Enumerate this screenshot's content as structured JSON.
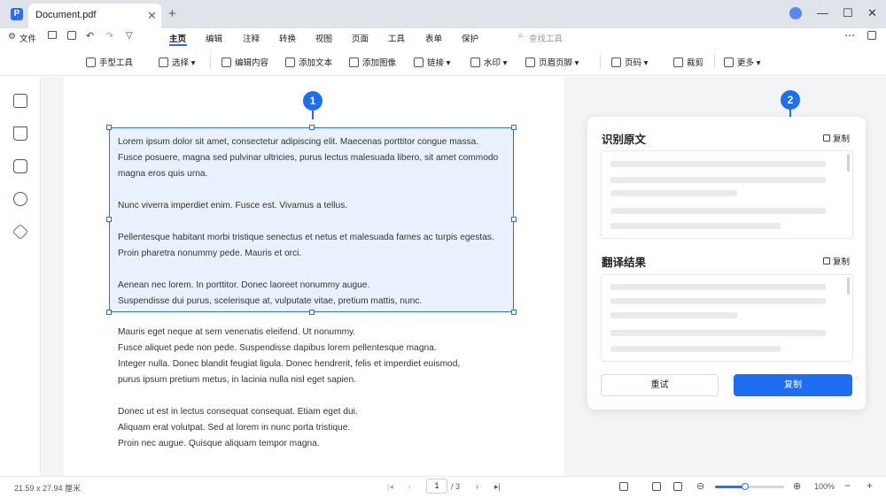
{
  "window": {
    "tab_title": "Document.pdf",
    "logo_letter": "P",
    "new_tab": "+",
    "tab_close": "✕",
    "controls": [
      "—",
      "☐",
      "✕"
    ]
  },
  "menu": {
    "file": "文件",
    "tabs": [
      "主页",
      "编辑",
      "注释",
      "转换",
      "视图",
      "页面",
      "工具",
      "表单",
      "保护"
    ],
    "active_tab": "主页",
    "search_placeholder": "查找工具",
    "more": "⋯"
  },
  "toolbar": {
    "items": [
      "手型工具",
      "选择",
      "编辑内容",
      "添加文本",
      "添加图像",
      "链接",
      "水印",
      "页眉页脚",
      "页码",
      "裁剪",
      "更多"
    ]
  },
  "document": {
    "selected_paragraphs": [
      [
        "Lorem ipsum dolor sit amet, consectetur adipiscing elit. Maecenas porttitor congue massa.",
        "Fusce posuere, magna sed pulvinar ultricies, purus lectus malesuada libero, sit amet commodo",
        "magna eros quis urna."
      ],
      [
        "Nunc viverra imperdiet enim. Fusce est. Vivamus a tellus."
      ],
      [
        "Pellentesque habitant morbi tristique senectus et netus et malesuada fames ac turpis egestas.",
        "Proin pharetra nonummy pede. Mauris et orci."
      ],
      [
        "Aenean nec lorem. In porttitor. Donec laoreet nonummy augue.",
        "Suspendisse dui purus, scelerisque at, vulputate vitae, pretium mattis, nunc."
      ]
    ],
    "other_paragraphs": [
      [
        "Mauris eget neque at sem venenatis eleifend. Ut nonummy.",
        "Fusce aliquet pede non pede. Suspendisse dapibus lorem pellentesque magna.",
        "Integer nulla. Donec blandit feugiat ligula. Donec hendrerit, felis et imperdiet euismod,",
        "purus ipsum pretium metus, in lacinia nulla nisl eget sapien."
      ],
      [
        "Donec ut est in lectus consequat consequat. Etiam eget dui.",
        "Aliquam erat volutpat. Sed at lorem in nunc porta tristique.",
        "Proin nec augue. Quisque aliquam tempor magna."
      ]
    ]
  },
  "badges": [
    "1",
    "2"
  ],
  "panel": {
    "source_title": "识别原文",
    "result_title": "翻译结果",
    "copy_label": "复制",
    "retry_button": "重试",
    "copy_button": "复制"
  },
  "status": {
    "page_size": "21.59 x 27.94 厘米",
    "current_page": "1",
    "total_pages": "/ 3",
    "zoom": "100%",
    "zoom_fraction": 0.42
  },
  "colors": {
    "accent": "#1d6ef0",
    "selection_fill": "#eaf1fe"
  },
  "icons": [
    "hand-icon",
    "cursor-icon",
    "edit-icon",
    "add-text-icon",
    "image-icon",
    "link-icon",
    "watermark-icon",
    "header-footer-icon",
    "page-number-icon",
    "crop-icon",
    "more-icon"
  ]
}
